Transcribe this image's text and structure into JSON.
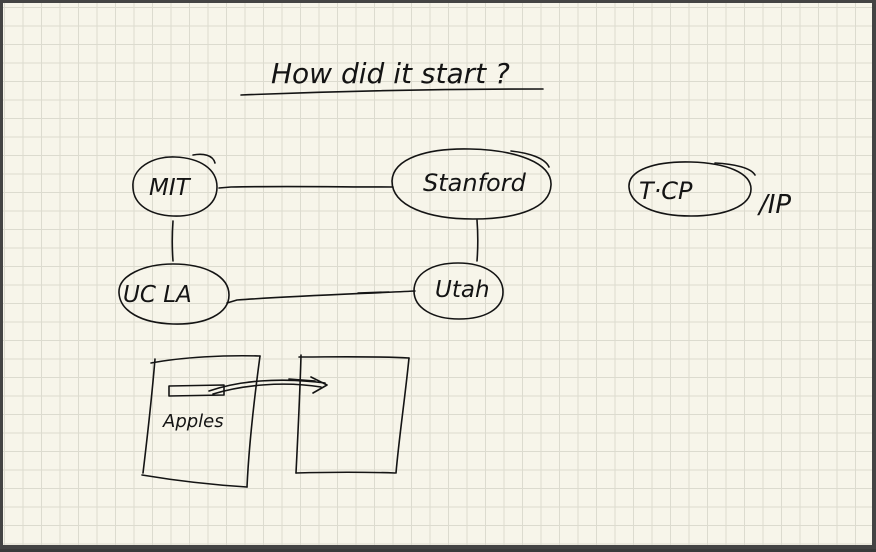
{
  "canvas": {
    "paper_color": "#f7f5ea",
    "grid_color": "#dcdbcf",
    "ink_color": "#141414"
  },
  "title": "How did it start ?",
  "nodes": {
    "mit": "MIT",
    "stanford": "Stanford",
    "ucla": "UC LA",
    "utah": "Utah",
    "tcp": "T·CP",
    "tcp_suffix": "/IP"
  },
  "memory": {
    "label": "Apples"
  }
}
